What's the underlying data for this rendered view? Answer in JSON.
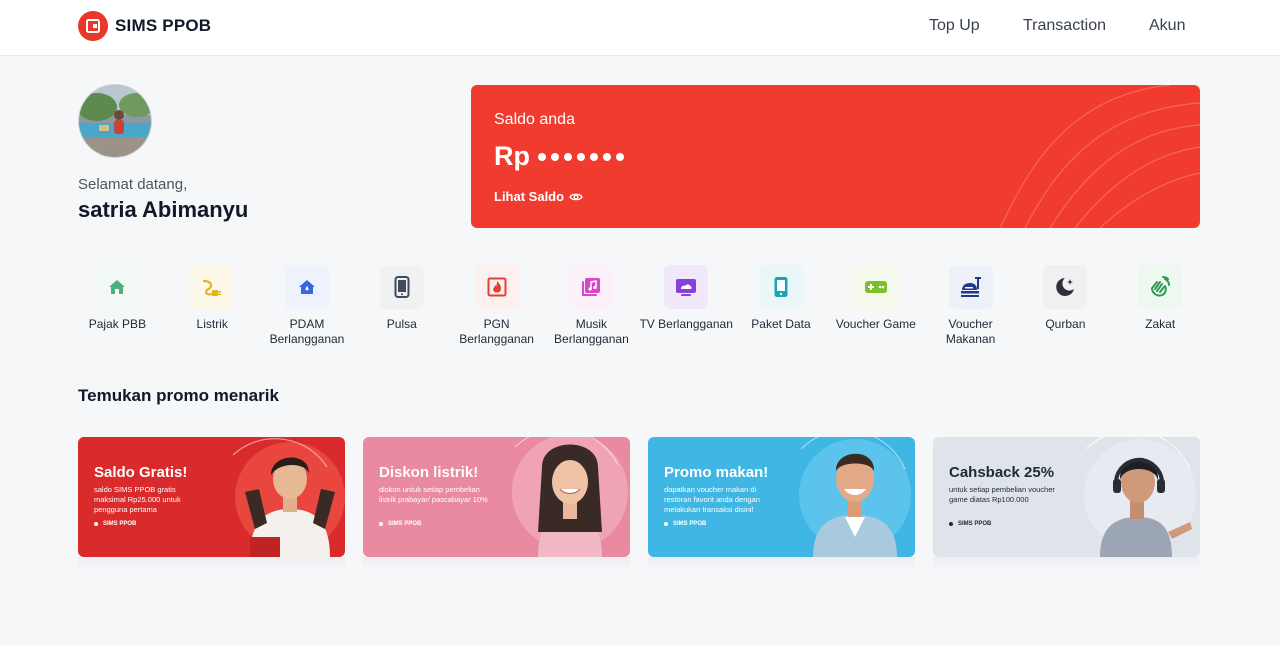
{
  "app": {
    "name": "SIMS PPOB",
    "brand_color": "#e8382b"
  },
  "nav": {
    "links": [
      "Top Up",
      "Transaction",
      "Akun"
    ]
  },
  "profile": {
    "greeting": "Selamat datang,",
    "name": "satria Abimanyu"
  },
  "balance": {
    "label": "Saldo anda",
    "currency": "Rp",
    "masked": true,
    "mask_dots": 7,
    "toggle_label": "Lihat Saldo",
    "card_color": "#f13b2f"
  },
  "services": [
    {
      "label": "Pajak PBB",
      "icon": "house-icon",
      "color": "#4caf7d",
      "bg": "#f2f8f4"
    },
    {
      "label": "Listrik",
      "icon": "electric-plug-icon",
      "color": "#e6b325",
      "bg": "#fdf8ea"
    },
    {
      "label": "PDAM Berlangganan",
      "icon": "water-home-icon",
      "color": "#3b63e3",
      "bg": "#eef2fc"
    },
    {
      "label": "Pulsa",
      "icon": "phone-icon",
      "color": "#3f4a5a",
      "bg": "#f0f1f3"
    },
    {
      "label": "PGN Berlangganan",
      "icon": "gas-flame-icon",
      "color": "#e2412f",
      "bg": "#fdf0ee"
    },
    {
      "label": "Musik Berlangganan",
      "icon": "music-icon",
      "color": "#d946c8",
      "bg": "#fcf0fb"
    },
    {
      "label": "TV Berlangganan",
      "icon": "tv-icon",
      "color": "#8b3fd9",
      "bg": "#f1e8fb"
    },
    {
      "label": "Paket Data",
      "icon": "mobile-data-icon",
      "color": "#1aa3b8",
      "bg": "#eaf7f9"
    },
    {
      "label": "Voucher Game",
      "icon": "gamepad-icon",
      "color": "#7bbf2a",
      "bg": "#f4f9ec"
    },
    {
      "label": "Voucher Makanan",
      "icon": "food-tray-icon",
      "color": "#1e3a8a",
      "bg": "#eef1f8"
    },
    {
      "label": "Qurban",
      "icon": "moon-star-icon",
      "color": "#2f2f3a",
      "bg": "#f0f0f2"
    },
    {
      "label": "Zakat",
      "icon": "hands-icon",
      "color": "#2e9a4f",
      "bg": "#eef8f1"
    }
  ],
  "promos": {
    "title": "Temukan promo menarik",
    "items": [
      {
        "headline": "Saldo Gratis!",
        "description": "saldo SIMS PPOB gratis maksimal Rp25.000 untuk pengguna pertama",
        "brand": "SIMS PPOB",
        "bg": "#d92b2b"
      },
      {
        "headline": "Diskon listrik!",
        "description": "diskon untuk setiap pembelian listrik prabayar/ pascabayar 10%",
        "brand": "SIMS PPOB",
        "bg": "#e98aa0"
      },
      {
        "headline": "Promo makan!",
        "description": "dapatkan voucher makan di restoran favorit anda dengan melakukan transaksi disini!",
        "brand": "SIMS PPOB",
        "bg": "#3fb6e4"
      },
      {
        "headline": "Cahsback 25%",
        "description": "untuk setiap pembelian voucher game diatas Rp100.000",
        "brand": "SIMS PPOB",
        "bg": "#dfe3ea"
      }
    ]
  }
}
